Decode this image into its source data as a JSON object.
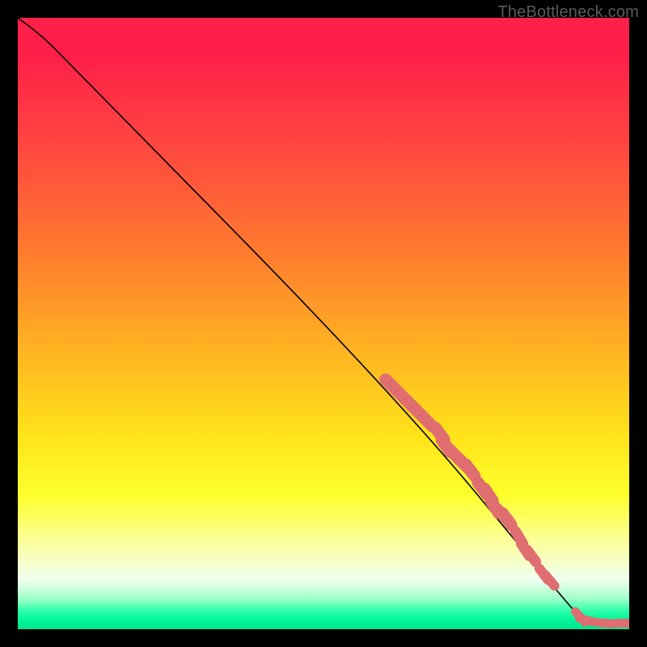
{
  "credit": "TheBottleneck.com",
  "colors": {
    "marker": "#e06d70",
    "line": "#000000"
  },
  "chart_data": {
    "type": "line",
    "title": "",
    "xlabel": "",
    "ylabel": "",
    "xlim": [
      0,
      100
    ],
    "ylim": [
      0,
      100
    ],
    "grid": false,
    "legend": false,
    "curve": [
      {
        "x": 0,
        "y": 100
      },
      {
        "x": 4,
        "y": 97
      },
      {
        "x": 8,
        "y": 93
      },
      {
        "x": 62,
        "y": 38
      },
      {
        "x": 90,
        "y": 4
      },
      {
        "x": 93,
        "y": 1
      },
      {
        "x": 100,
        "y": 1
      }
    ],
    "markers": [
      {
        "x": 61,
        "y": 40,
        "w": 2.5
      },
      {
        "x": 62,
        "y": 39,
        "w": 2.5
      },
      {
        "x": 63,
        "y": 38,
        "w": 2.5
      },
      {
        "x": 64,
        "y": 37,
        "w": 2.5
      },
      {
        "x": 65,
        "y": 36,
        "w": 2.5
      },
      {
        "x": 66,
        "y": 35,
        "w": 2.5
      },
      {
        "x": 67,
        "y": 34,
        "w": 2.5
      },
      {
        "x": 69,
        "y": 32,
        "w": 2.5
      },
      {
        "x": 70,
        "y": 30,
        "w": 2.5
      },
      {
        "x": 71,
        "y": 29,
        "w": 2.5
      },
      {
        "x": 72,
        "y": 28,
        "w": 2.5
      },
      {
        "x": 73,
        "y": 27,
        "w": 2.5
      },
      {
        "x": 74,
        "y": 26,
        "w": 2.5
      },
      {
        "x": 76,
        "y": 23,
        "w": 2.5
      },
      {
        "x": 77,
        "y": 22,
        "w": 2.5
      },
      {
        "x": 78,
        "y": 20,
        "w": 2.5
      },
      {
        "x": 79,
        "y": 19,
        "w": 2.5
      },
      {
        "x": 80,
        "y": 18,
        "w": 2.5
      },
      {
        "x": 82,
        "y": 15,
        "w": 2.2
      },
      {
        "x": 83,
        "y": 13,
        "w": 2.2
      },
      {
        "x": 84,
        "y": 12,
        "w": 2.2
      },
      {
        "x": 86,
        "y": 9,
        "w": 2.0
      },
      {
        "x": 87,
        "y": 8,
        "w": 2.0
      },
      {
        "x": 92,
        "y": 2,
        "w": 1.8
      },
      {
        "x": 93,
        "y": 1.5,
        "w": 1.8
      },
      {
        "x": 96,
        "y": 1,
        "w": 1.8
      },
      {
        "x": 99,
        "y": 1,
        "w": 1.8
      },
      {
        "x": 100,
        "y": 1,
        "w": 1.8
      }
    ]
  }
}
